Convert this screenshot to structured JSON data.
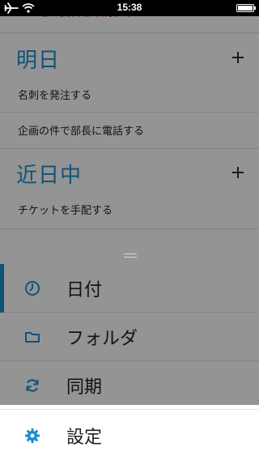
{
  "status_bar": {
    "time": "15:38"
  },
  "task_list": {
    "partial_task": "プレゼン資料を印刷する",
    "sections": [
      {
        "title": "明日",
        "tasks": [
          "名刺を発注する",
          "企画の件で部長に電話する"
        ]
      },
      {
        "title": "近日中",
        "tasks": [
          "チケットを手配する"
        ]
      }
    ]
  },
  "menu": {
    "items": [
      {
        "label": "日付",
        "icon": "clock-icon",
        "active": true
      },
      {
        "label": "フォルダ",
        "icon": "folder-icon",
        "active": false
      },
      {
        "label": "同期",
        "icon": "sync-icon",
        "active": false
      }
    ],
    "settings": {
      "label": "設定",
      "icon": "gear-icon"
    }
  },
  "colors": {
    "accent": "#1b8fcf",
    "partial_task": "#e0465e"
  }
}
